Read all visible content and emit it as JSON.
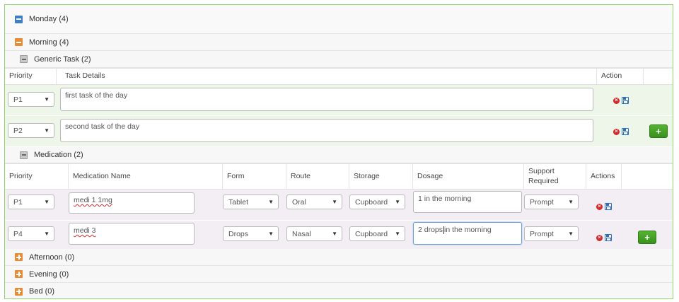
{
  "monday": {
    "label": "Monday (4)"
  },
  "morning": {
    "label": "Morning (4)"
  },
  "generic_task": {
    "label": "Generic Task (2)",
    "headers": {
      "priority": "Priority",
      "task_details": "Task Details",
      "action": "Action"
    },
    "rows": [
      {
        "priority": "P1",
        "details": "first task of the day"
      },
      {
        "priority": "P2",
        "details": "second task of the day"
      }
    ],
    "add_label": "+"
  },
  "medication": {
    "label": "Medication (2)",
    "headers": {
      "priority": "Priority",
      "name": "Medication Name",
      "form": "Form",
      "route": "Route",
      "storage": "Storage",
      "dosage": "Dosage",
      "support": "Support Required",
      "actions": "Actions"
    },
    "rows": [
      {
        "priority": "P1",
        "name": "medi 1 1mg",
        "form": "Tablet",
        "route": "Oral",
        "storage": "Cupboard",
        "dosage": "1 in the morning",
        "support": "Prompt"
      },
      {
        "priority": "P4",
        "name": "medi 3",
        "form": "Drops",
        "route": "Nasal",
        "storage": "Cupboard",
        "dosage_before_caret": "2 drops",
        "dosage_after_caret": "in the morning",
        "support": "Prompt"
      }
    ],
    "add_label": "+"
  },
  "afternoon": {
    "label": "Afternoon (0)"
  },
  "evening": {
    "label": "Evening (0)"
  },
  "bed": {
    "label": "Bed (0)"
  },
  "icons": {
    "delete": "delete-icon",
    "save": "save-icon",
    "arrow": "▼"
  },
  "colors": {
    "accent_green": "#4aa526",
    "blue_toggle": "#3d7fc6",
    "orange_toggle": "#e98b33",
    "delete_red": "#d8262c",
    "save_blue": "#2a6fc2"
  }
}
